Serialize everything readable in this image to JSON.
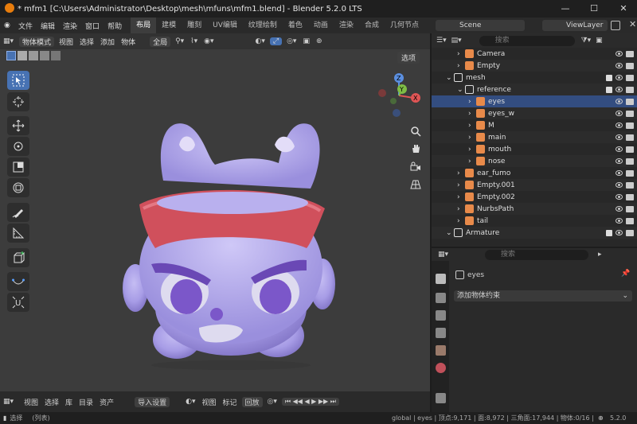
{
  "window": {
    "title": "* mfm1 [C:\\Users\\Administrator\\Desktop\\mesh\\mfuns\\mfm1.blend] - Blender 5.2.0 LTS",
    "min": "—",
    "max": "☐",
    "close": "✕"
  },
  "menu": [
    "文件",
    "编辑",
    "渲染",
    "窗口",
    "帮助"
  ],
  "workspaces": [
    "布局",
    "建模",
    "雕刻",
    "UV编辑",
    "纹理绘制",
    "着色",
    "动画",
    "渲染",
    "合成",
    "几何节点"
  ],
  "scene": {
    "label": "Scene",
    "viewlayer": "ViewLayer"
  },
  "viewport": {
    "mode": "物体模式",
    "menus": [
      "视图",
      "选择",
      "添加",
      "物体"
    ],
    "orientation": "全局",
    "options": "选项",
    "gizmo": {
      "x": "X",
      "y": "Y",
      "z": "Z"
    }
  },
  "outliner": {
    "search_placeholder": "搜索",
    "rows": [
      {
        "label": "Camera",
        "indent": 2,
        "kind": "camera"
      },
      {
        "label": "Empty",
        "indent": 2,
        "kind": "empty"
      },
      {
        "label": "mesh",
        "indent": 1,
        "kind": "collection"
      },
      {
        "label": "reference",
        "indent": 2,
        "kind": "collection"
      },
      {
        "label": "eyes",
        "indent": 3,
        "kind": "mesh"
      },
      {
        "label": "eyes_w",
        "indent": 3,
        "kind": "mesh"
      },
      {
        "label": "M",
        "indent": 3,
        "kind": "mesh"
      },
      {
        "label": "main",
        "indent": 3,
        "kind": "mesh"
      },
      {
        "label": "mouth",
        "indent": 3,
        "kind": "mesh"
      },
      {
        "label": "nose",
        "indent": 3,
        "kind": "mesh"
      },
      {
        "label": "ear_fumo",
        "indent": 2,
        "kind": "mesh"
      },
      {
        "label": "Empty.001",
        "indent": 2,
        "kind": "empty"
      },
      {
        "label": "Empty.002",
        "indent": 2,
        "kind": "empty"
      },
      {
        "label": "NurbsPath",
        "indent": 2,
        "kind": "curve"
      },
      {
        "label": "tail",
        "indent": 2,
        "kind": "mesh"
      },
      {
        "label": "Armature",
        "indent": 1,
        "kind": "collection"
      }
    ]
  },
  "properties": {
    "search_placeholder": "搜索",
    "object_name": "eyes",
    "add_constraint": "添加物体约束"
  },
  "timeline": {
    "menus": [
      "视图",
      "选择",
      "库",
      "目录",
      "资产"
    ],
    "import_settings": "导入设置",
    "menus2": [
      "视图",
      "标记"
    ],
    "playback": "回放"
  },
  "status": {
    "left": "选择",
    "left2": "(列表)",
    "right": "global | eyes | 顶点:9,171 | 面:8,972 | 三角面:17,944 | 物体:0/16 |",
    "version": "5.2.0"
  },
  "colors": {
    "accent": "#4772b3",
    "header_band": "#d0505c",
    "body": "#a79ce6",
    "eye_purple": "#7b57c9"
  }
}
